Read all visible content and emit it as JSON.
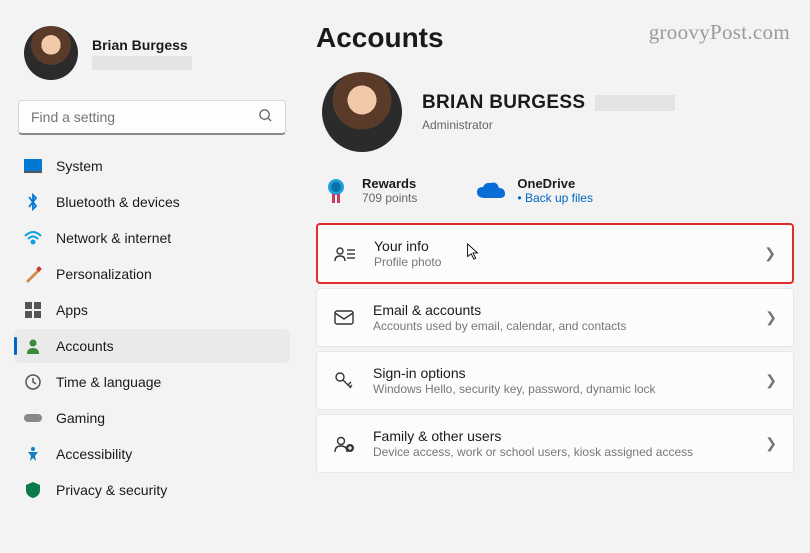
{
  "watermark": "groovyPost.com",
  "user": {
    "name": "Brian Burgess"
  },
  "search": {
    "placeholder": "Find a setting"
  },
  "nav": [
    {
      "label": "System"
    },
    {
      "label": "Bluetooth & devices"
    },
    {
      "label": "Network & internet"
    },
    {
      "label": "Personalization"
    },
    {
      "label": "Apps"
    },
    {
      "label": "Accounts"
    },
    {
      "label": "Time & language"
    },
    {
      "label": "Gaming"
    },
    {
      "label": "Accessibility"
    },
    {
      "label": "Privacy & security"
    }
  ],
  "page": {
    "title": "Accounts",
    "hero_name": "BRIAN BURGESS",
    "hero_role": "Administrator"
  },
  "tiles": {
    "rewards_label": "Rewards",
    "rewards_sub": "709 points",
    "onedrive_label": "OneDrive",
    "onedrive_sub": "Back up files"
  },
  "cards": [
    {
      "title": "Your info",
      "sub": "Profile photo"
    },
    {
      "title": "Email & accounts",
      "sub": "Accounts used by email, calendar, and contacts"
    },
    {
      "title": "Sign-in options",
      "sub": "Windows Hello, security key, password, dynamic lock"
    },
    {
      "title": "Family & other users",
      "sub": "Device access, work or school users, kiosk assigned access"
    }
  ]
}
